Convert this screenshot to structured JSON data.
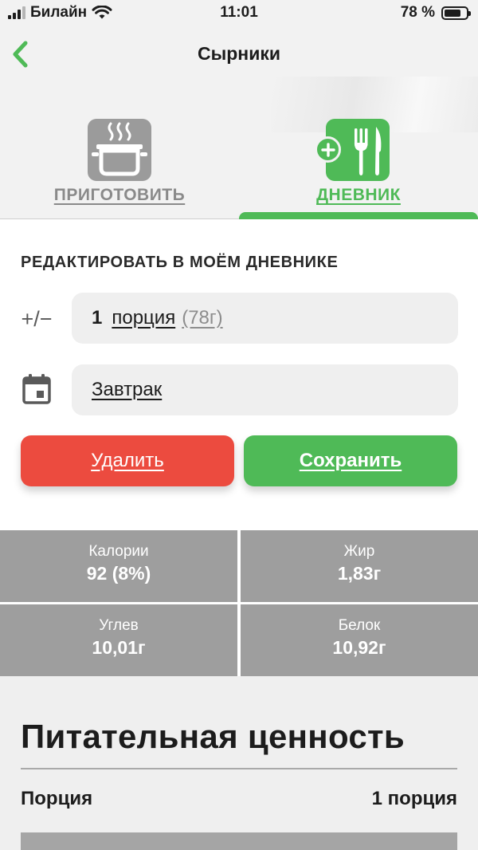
{
  "status_bar": {
    "carrier": "Билайн",
    "time": "11:01",
    "battery_percent": "78 %",
    "battery_level": 0.78
  },
  "header": {
    "title": "Сырники",
    "back_icon": "chevron-left-icon"
  },
  "tabs": [
    {
      "label": "ПРИГОТОВИТЬ",
      "icon": "cooking-pot-icon",
      "active": false
    },
    {
      "label": "ДНЕВНИК",
      "icon": "add-fork-knife-icon",
      "active": true
    }
  ],
  "edit": {
    "section_title": "РЕДАКТИРОВАТЬ В МОЁМ ДНЕВНИКЕ",
    "plusminus_symbol": "+/−",
    "portion_count": "1",
    "portion_unit": "порция",
    "portion_weight": "(78г)",
    "meal": "Завтрак",
    "delete_label": "Удалить",
    "save_label": "Сохранить"
  },
  "nutrients": [
    {
      "label": "Калории",
      "value": "92 (8%)"
    },
    {
      "label": "Жир",
      "value": "1,83г"
    },
    {
      "label": "Углев",
      "value": "10,01г"
    },
    {
      "label": "Белок",
      "value": "10,92г"
    }
  ],
  "nutrition": {
    "heading": "Питательная ценность",
    "portion_label": "Порция",
    "portion_value": "1 порция"
  },
  "colors": {
    "accent_green": "#4fba57",
    "delete_red": "#ec4b3f",
    "cell_gray": "#9e9e9e",
    "inactive_gray": "#8a8a8a"
  }
}
